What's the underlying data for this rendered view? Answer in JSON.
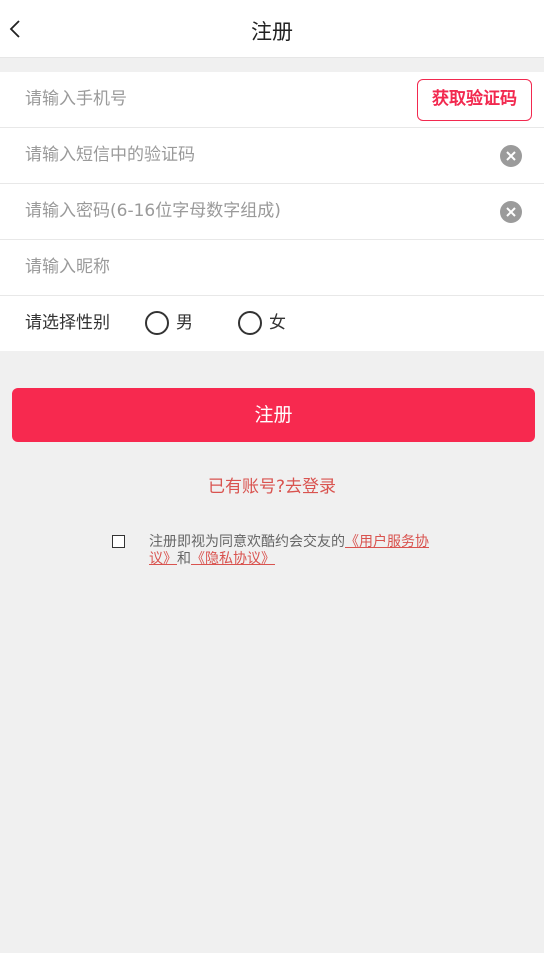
{
  "header": {
    "title": "注册",
    "back_icon": "chevron-left-icon"
  },
  "form": {
    "phone_placeholder": "请输入手机号",
    "get_code_label": "获取验证码",
    "sms_code_placeholder": "请输入短信中的验证码",
    "password_placeholder": "请输入密码(6-16位字母数字组成)",
    "nickname_placeholder": "请输入昵称",
    "gender_label": "请选择性别",
    "gender_options": [
      "男",
      "女"
    ],
    "clear_icon": "clear-circle-icon"
  },
  "actions": {
    "submit_label": "注册",
    "login_link": "已有账号?去登录"
  },
  "agreement": {
    "prefix": "注册即视为同意欢酷约会交友的",
    "service_link": "《用户服务协议》",
    "connector": "和",
    "privacy_link": "《隐私协议》"
  },
  "colors": {
    "accent": "#f7294f",
    "link": "#d9534f",
    "background": "#f0f0f0"
  }
}
